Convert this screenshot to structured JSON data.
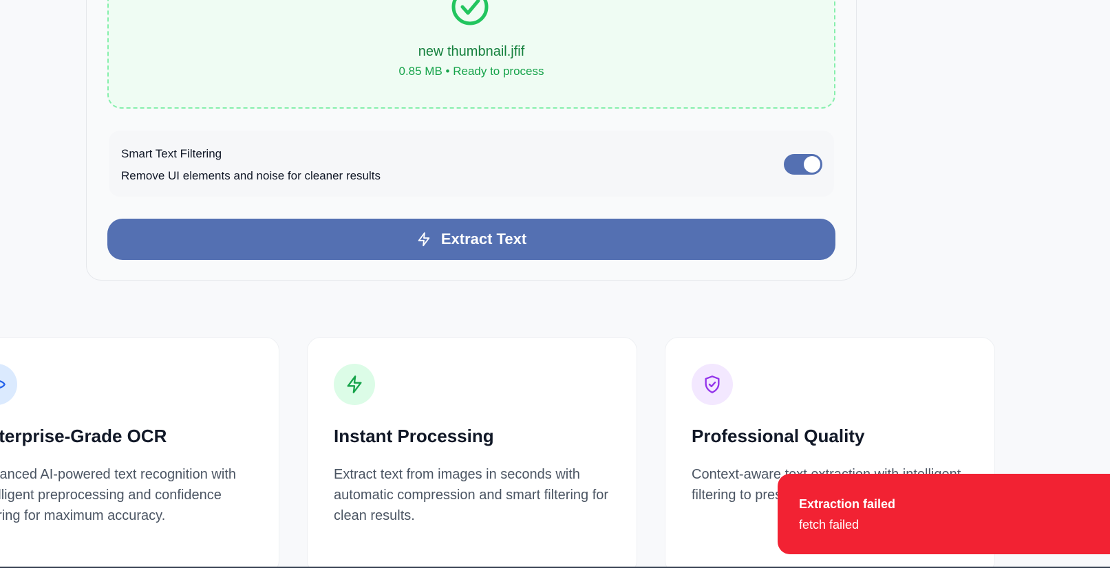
{
  "upload": {
    "file_name": "new thumbnail.jfif",
    "file_meta": "0.85 MB • Ready to process"
  },
  "filter": {
    "title": "Smart Text Filtering",
    "description": "Remove UI elements and noise for cleaner results",
    "enabled": true
  },
  "actions": {
    "extract_label": "Extract Text"
  },
  "features": [
    {
      "icon": "eye-icon",
      "title": "Enterprise-Grade OCR",
      "description": "Advanced AI-powered text recognition with intelligent preprocessing and confidence scoring for maximum accuracy."
    },
    {
      "icon": "bolt-icon",
      "title": "Instant Processing",
      "description": "Extract text from images in seconds with automatic compression and smart filtering for clean results."
    },
    {
      "icon": "shield-check-icon",
      "title": "Professional Quality",
      "description": "Context-aware text extraction with intelligent filtering to preserve meaning."
    }
  ],
  "toast": {
    "title": "Extraction failed",
    "message": "fetch failed"
  },
  "colors": {
    "primary": "#5470b2",
    "success": "#22c55e",
    "error": "#f22233"
  }
}
